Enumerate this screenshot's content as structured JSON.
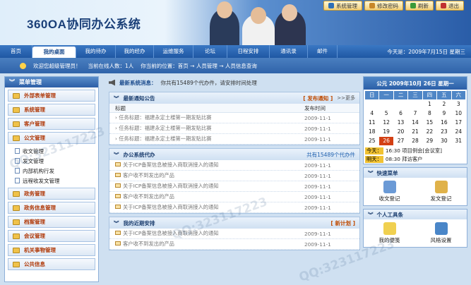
{
  "app": {
    "title": "360OA协同办公系统"
  },
  "toolbar": {
    "items": [
      {
        "label": "系统管理",
        "color": "#2e6fb7"
      },
      {
        "label": "修改密码",
        "color": "#c8872a"
      },
      {
        "label": "刷新",
        "color": "#3a9a3a"
      },
      {
        "label": "退出",
        "color": "#c03030"
      }
    ]
  },
  "nav": {
    "items": [
      "首页",
      "我的桌面",
      "我的待办",
      "我的经办",
      "运维服务",
      "论坛",
      "日程安排",
      "通讯录",
      "邮件"
    ],
    "active_index": 1,
    "date_text": "今天是：2009年7月15日 星期三"
  },
  "status": {
    "welcome": "欢迎您超级管理员！",
    "online": "当前在线人数：1人",
    "breadcrumb": "你当前的位置：首页 → 人员管理 → 人员信息查询"
  },
  "sidebar": {
    "title": "菜单管理",
    "items": [
      {
        "label": "外部表单管理"
      },
      {
        "label": "系统管理"
      },
      {
        "label": "客户管理"
      },
      {
        "label": "公文管理",
        "children": [
          "收文管理",
          "发文管理",
          "内部机构行发",
          "远程收发文管理"
        ]
      },
      {
        "label": "政务管理"
      },
      {
        "label": "政务信息管理"
      },
      {
        "label": "档案管理"
      },
      {
        "label": "会议管理"
      },
      {
        "label": "机关事物管理"
      },
      {
        "label": "公共信息"
      }
    ]
  },
  "sysmsg": {
    "label": "最新系统消息：",
    "text": "你共有15489个代办件，请安排时间处理"
  },
  "notice_panel": {
    "title": "最新通知公告",
    "action": "[ 发布通知 ]",
    "more": ">>更多",
    "col_title": "标题",
    "col_date": "发布时间",
    "rows": [
      {
        "title": "任务标题：福建永定土楼第一期发贴比赛",
        "date": "2009-11-1"
      },
      {
        "title": "任务标题：福建永定土楼第一期发贴比赛",
        "date": "2009-11-1"
      },
      {
        "title": "任务标题：福建永定土楼第一期发贴比赛",
        "date": "2009-11-1"
      }
    ]
  },
  "todo_panel": {
    "title": "办公系统代办",
    "action": "共有15489个代办件",
    "rows": [
      {
        "title": "关于ICP备案信息被接入商取消接入的通知",
        "date": "2009-11-1"
      },
      {
        "title": "客户收不到发出的产品",
        "date": "2009-11-1"
      },
      {
        "title": "关于ICP备案信息被接入商取消接入的通知",
        "date": "2009-11-1"
      },
      {
        "title": "客户收不到发出的产品",
        "date": "2009-11-1"
      },
      {
        "title": "关于ICP备案信息被接入商取消接入的通知",
        "date": "2009-11-1"
      }
    ]
  },
  "schedule_panel": {
    "title": "我的近期安排",
    "action": "[ 新计划 ]",
    "rows": [
      {
        "title": "关于ICP备案信息被接入商取消接入的通知",
        "date": "2009-11-1"
      },
      {
        "title": "客户收不到发出的产品",
        "date": "2009-11-1"
      }
    ]
  },
  "calendar": {
    "title": "公元 2009年10月 26日 星期一",
    "dows": [
      "日",
      "一",
      "二",
      "三",
      "四",
      "五",
      "六"
    ],
    "weeks": [
      [
        "",
        "",
        "",
        "",
        "1",
        "2",
        "3"
      ],
      [
        "4",
        "5",
        "6",
        "7",
        "8",
        "9",
        "10"
      ],
      [
        "11",
        "12",
        "13",
        "14",
        "15",
        "16",
        "17"
      ],
      [
        "18",
        "19",
        "20",
        "21",
        "22",
        "23",
        "24"
      ],
      [
        "25",
        "26",
        "27",
        "28",
        "29",
        "30",
        "31"
      ]
    ],
    "today": "26",
    "notes": [
      {
        "tag": "今天：",
        "text": "16:30 项目例会[会议室]"
      },
      {
        "tag": "明天：",
        "text": "08:30 拜访客户"
      }
    ]
  },
  "quick_menu": {
    "title": "快速菜单",
    "items": [
      {
        "label": "收文登记",
        "color": "#6b9ad6"
      },
      {
        "label": "发文登记",
        "color": "#e0b24a"
      }
    ]
  },
  "tools": {
    "title": "个人工具条",
    "items": [
      {
        "label": "我的便笺",
        "color": "#f0d050"
      },
      {
        "label": "风格设置",
        "color": "#4a86c8"
      }
    ]
  },
  "watermark": "QQ:323117223"
}
